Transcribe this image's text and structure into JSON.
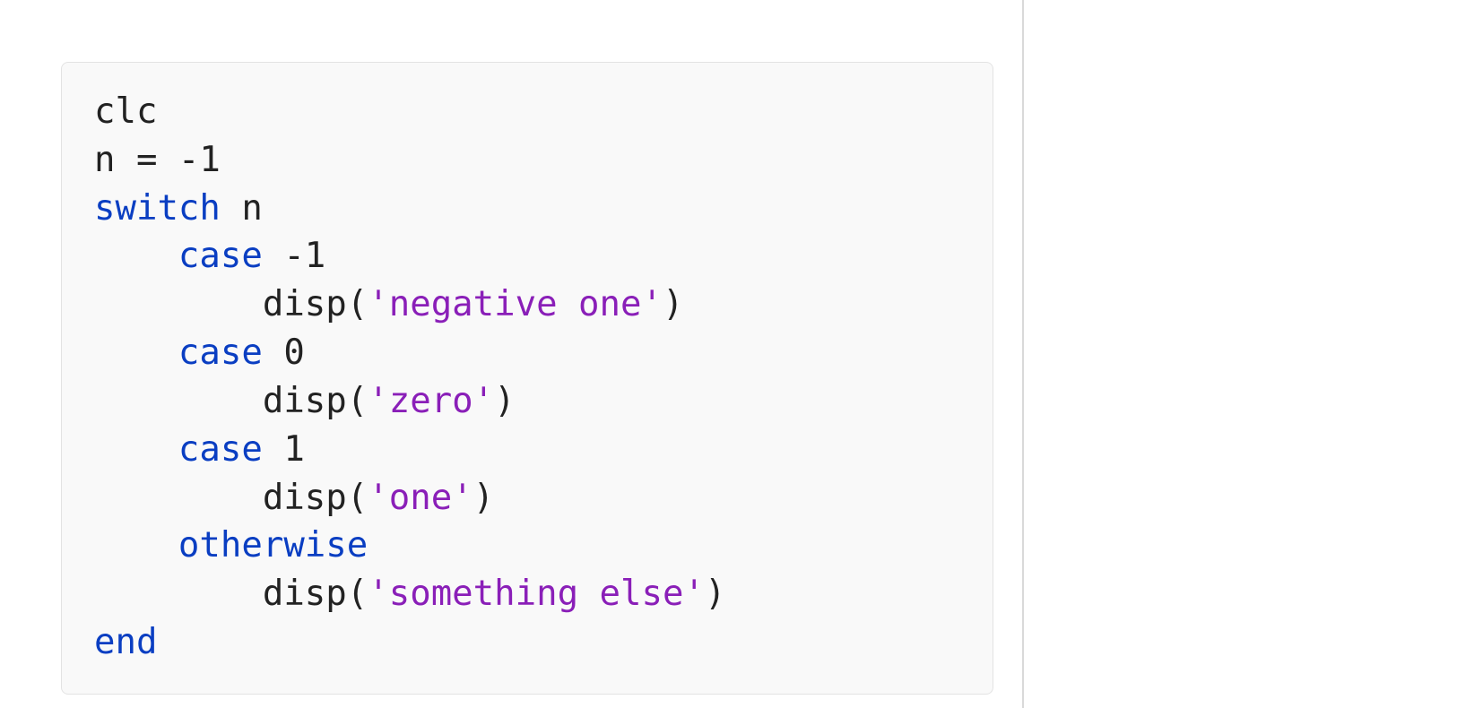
{
  "code": {
    "lines": [
      {
        "indent": 0,
        "tokens": [
          {
            "t": "txt",
            "v": "clc"
          }
        ]
      },
      {
        "indent": 0,
        "tokens": [
          {
            "t": "txt",
            "v": "n = -1"
          }
        ]
      },
      {
        "indent": 0,
        "tokens": [
          {
            "t": "kw",
            "v": "switch"
          },
          {
            "t": "txt",
            "v": " n"
          }
        ]
      },
      {
        "indent": 1,
        "tokens": [
          {
            "t": "kw",
            "v": "case"
          },
          {
            "t": "txt",
            "v": " -1"
          }
        ]
      },
      {
        "indent": 2,
        "tokens": [
          {
            "t": "txt",
            "v": "disp("
          },
          {
            "t": "str",
            "v": "'negative one'"
          },
          {
            "t": "txt",
            "v": ")"
          }
        ]
      },
      {
        "indent": 1,
        "tokens": [
          {
            "t": "kw",
            "v": "case"
          },
          {
            "t": "txt",
            "v": " 0"
          }
        ]
      },
      {
        "indent": 2,
        "tokens": [
          {
            "t": "txt",
            "v": "disp("
          },
          {
            "t": "str",
            "v": "'zero'"
          },
          {
            "t": "txt",
            "v": ")"
          }
        ]
      },
      {
        "indent": 1,
        "tokens": [
          {
            "t": "kw",
            "v": "case"
          },
          {
            "t": "txt",
            "v": " 1"
          }
        ]
      },
      {
        "indent": 2,
        "tokens": [
          {
            "t": "txt",
            "v": "disp("
          },
          {
            "t": "str",
            "v": "'one'"
          },
          {
            "t": "txt",
            "v": ")"
          }
        ]
      },
      {
        "indent": 1,
        "tokens": [
          {
            "t": "kw",
            "v": "otherwise"
          }
        ]
      },
      {
        "indent": 2,
        "tokens": [
          {
            "t": "txt",
            "v": "disp("
          },
          {
            "t": "str",
            "v": "'something else'"
          },
          {
            "t": "txt",
            "v": ")"
          }
        ]
      },
      {
        "indent": 0,
        "tokens": [
          {
            "t": "kw",
            "v": "end"
          }
        ]
      }
    ],
    "indent_unit": "    "
  },
  "colors": {
    "keyword": "#0a3ec2",
    "string": "#8a1fb8",
    "text": "#222222",
    "block_bg": "#f9f9f9",
    "block_border": "#e3e3e3",
    "divider": "#d9d9d9"
  }
}
